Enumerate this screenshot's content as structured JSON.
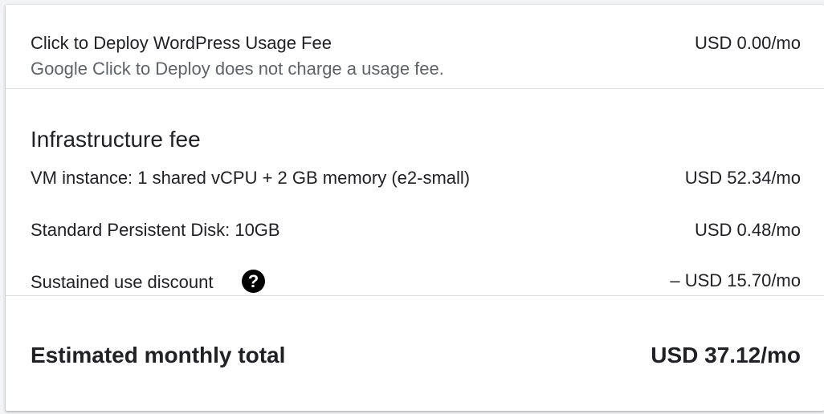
{
  "usage_fee": {
    "label": "Click to Deploy WordPress Usage Fee",
    "value": "USD 0.00/mo",
    "note": "Google Click to Deploy does not charge a usage fee."
  },
  "infrastructure": {
    "heading": "Infrastructure fee",
    "items": [
      {
        "label": "VM instance: 1 shared vCPU + 2 GB memory (e2-small)",
        "value": "USD 52.34/mo"
      },
      {
        "label": "Standard Persistent Disk: 10GB",
        "value": "USD 0.48/mo"
      },
      {
        "label": "Sustained use discount",
        "value": "– USD 15.70/mo",
        "help_icon": "help-circle-icon",
        "help_glyph": "?"
      }
    ]
  },
  "total": {
    "label": "Estimated monthly total",
    "value": "USD 37.12/mo"
  }
}
